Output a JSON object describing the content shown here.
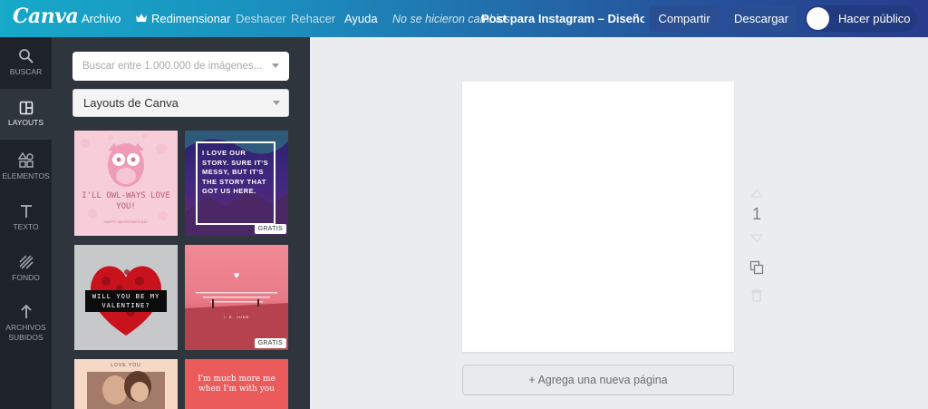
{
  "app": {
    "logo": "Canva"
  },
  "toolbar": {
    "file": "Archivo",
    "resize": "Redimensionar",
    "undo": "Deshacer",
    "redo": "Rehacer",
    "help": "Ayuda",
    "status": "No se hicieron cambios",
    "doc_title": "Post para Instagram – Diseño sin nombre",
    "share": "Compartir",
    "download": "Descargar",
    "publish": "Hacer público"
  },
  "rail": {
    "items": [
      {
        "label": "BUSCAR",
        "icon": "search-icon"
      },
      {
        "label": "LAYOUTS",
        "icon": "layouts-icon"
      },
      {
        "label": "ELEMENTOS",
        "icon": "elements-icon"
      },
      {
        "label": "TEXTO",
        "icon": "text-icon"
      },
      {
        "label": "FONDO",
        "icon": "background-icon"
      },
      {
        "label": "ARCHIVOS SUBIDOS",
        "icon": "upload-icon"
      }
    ],
    "active": "LAYOUTS"
  },
  "panel": {
    "search_placeholder": "Buscar entre 1.000.000 de imágenes...",
    "layout_select": "Layouts de Canva",
    "thumbnails": [
      {
        "text": "I'LL OWL-WAYS LOVE YOU!",
        "subtext": "HAPPY VALENTINE'S DAY",
        "badge": ""
      },
      {
        "text": "I LOVE OUR STORY. SURE IT'S MESSY, BUT IT'S THE STORY THAT GOT US HERE.",
        "badge": "GRATIS"
      },
      {
        "text": "WILL YOU BE MY VALENTINE?",
        "badge": ""
      },
      {
        "text": "♥",
        "subtext": "I. E. JUNE",
        "badge": "GRATIS"
      },
      {
        "text": "LOVE YOU",
        "badge": ""
      },
      {
        "text": "I'm much more me when I'm with you",
        "badge": ""
      }
    ]
  },
  "canvas": {
    "page_number": "1",
    "add_page": "+ Agrega una nueva página"
  },
  "colors": {
    "accent": "#2a4e92",
    "rail_bg": "#1e2329",
    "panel_bg": "#2f353c"
  }
}
